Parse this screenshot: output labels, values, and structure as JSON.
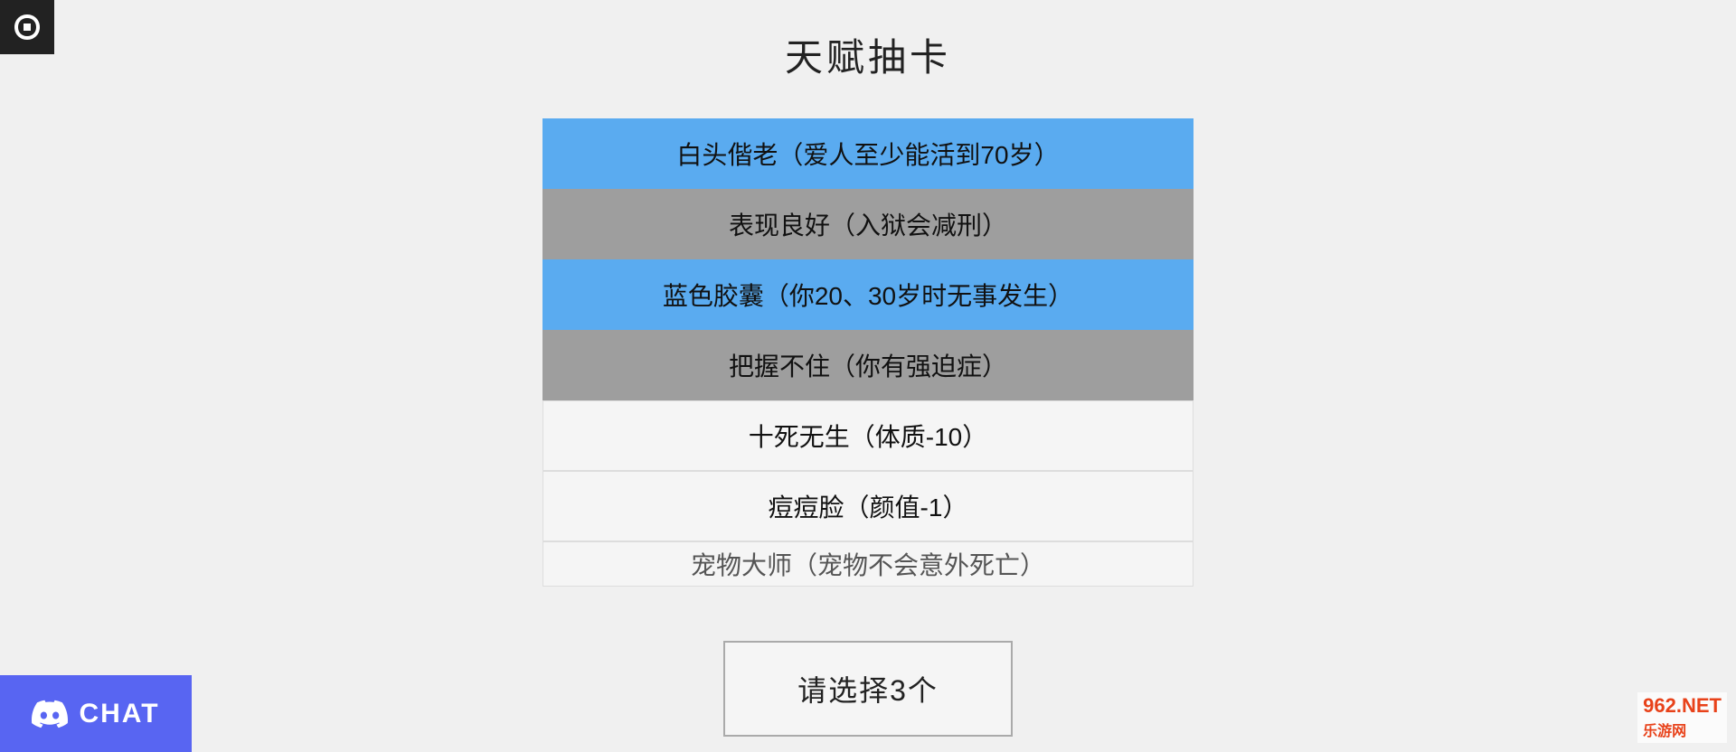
{
  "page": {
    "title": "天赋抽卡",
    "background": "#f0f0f0"
  },
  "items": [
    {
      "id": 1,
      "text": "白头偕老（爱人至少能活到70岁）",
      "style": "selected-blue"
    },
    {
      "id": 2,
      "text": "表现良好（入狱会减刑）",
      "style": "selected-gray"
    },
    {
      "id": 3,
      "text": "蓝色胶囊（你20、30岁时无事发生）",
      "style": "selected-blue"
    },
    {
      "id": 4,
      "text": "把握不住（你有强迫症）",
      "style": "selected-gray"
    },
    {
      "id": 5,
      "text": "十死无生（体质-10）",
      "style": "unselected"
    },
    {
      "id": 6,
      "text": "痘痘脸（颜值-1）",
      "style": "unselected"
    },
    {
      "id": 7,
      "text": "宠物大师（宠物不会意外死亡）",
      "style": "partial"
    }
  ],
  "action_button": {
    "label": "请选择3个"
  },
  "chat_button": {
    "label": "CHAT"
  },
  "watermark": {
    "site": "962.NET",
    "sub": "乐游网"
  }
}
